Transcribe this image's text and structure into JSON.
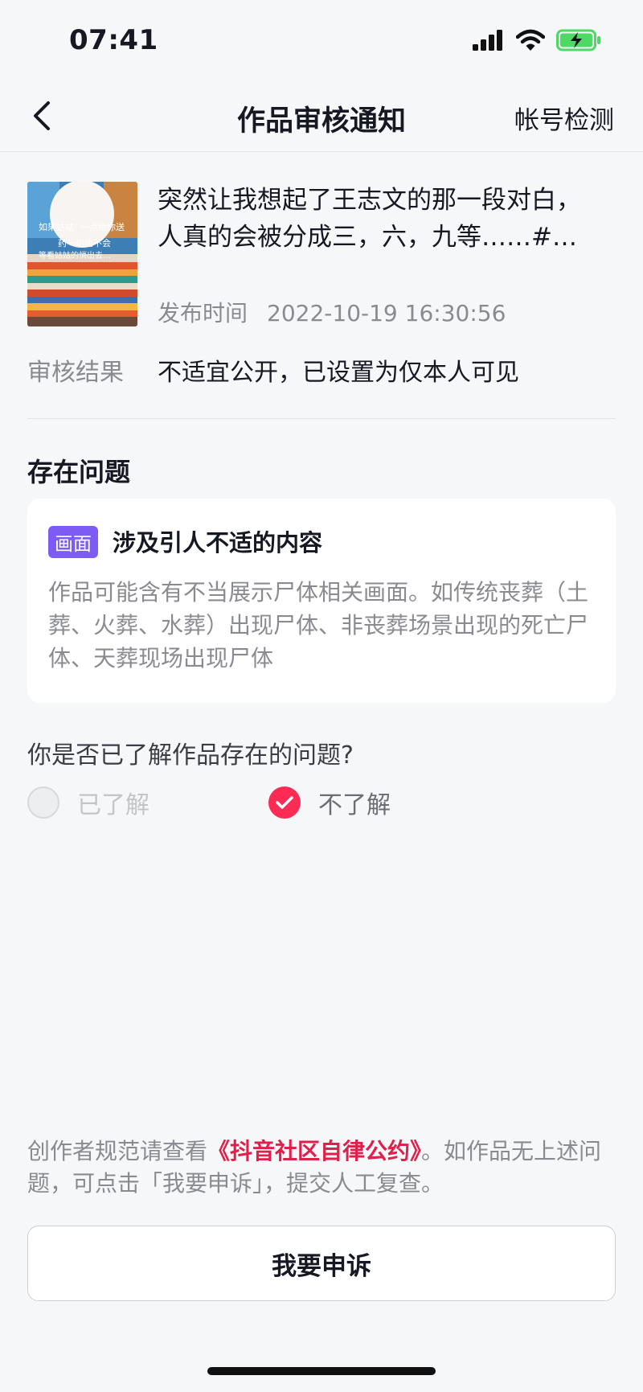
{
  "status_bar": {
    "time": "07:41"
  },
  "header": {
    "title": "作品审核通知",
    "right_action": "帐号检测"
  },
  "work": {
    "title_line1": "突然让我想起了王志文的那一段对白，",
    "title_line2": "人真的会被分成三，六，九等……#…",
    "publish_label": "发布时间",
    "publish_time": "2022-10-19 16:30:56",
    "thumbnail_text": [
      "如果姑姑",
      "一点给你送",
      "药一切也不会",
      "等看姑姑的悄出去…"
    ]
  },
  "review": {
    "result_label": "审核结果",
    "result_value": "不适宜公开，已设置为仅本人可见"
  },
  "issues": {
    "heading": "存在问题",
    "tag": "画面",
    "title": "涉及引人不适的内容",
    "description": "作品可能含有不当展示尸体相关画面。如传统丧葬（土葬、火葬、水葬）出现尸体、非丧葬场景出现的死亡尸体、天葬现场出现尸体"
  },
  "question": {
    "text": "你是否已了解作品存在的问题?",
    "options": [
      {
        "label": "已了解",
        "selected": false
      },
      {
        "label": "不了解",
        "selected": true
      }
    ]
  },
  "footer": {
    "text_before": "创作者规范请查看",
    "link": "《抖音社区自律公约》",
    "text_after": "。如作品无上述问题，可点击「我要申诉」，提交人工复查。"
  },
  "appeal_button": "我要申诉",
  "colors": {
    "accent": "#fe2c55",
    "tag_bg": "#7d5cf6",
    "link": "#e0204a"
  }
}
